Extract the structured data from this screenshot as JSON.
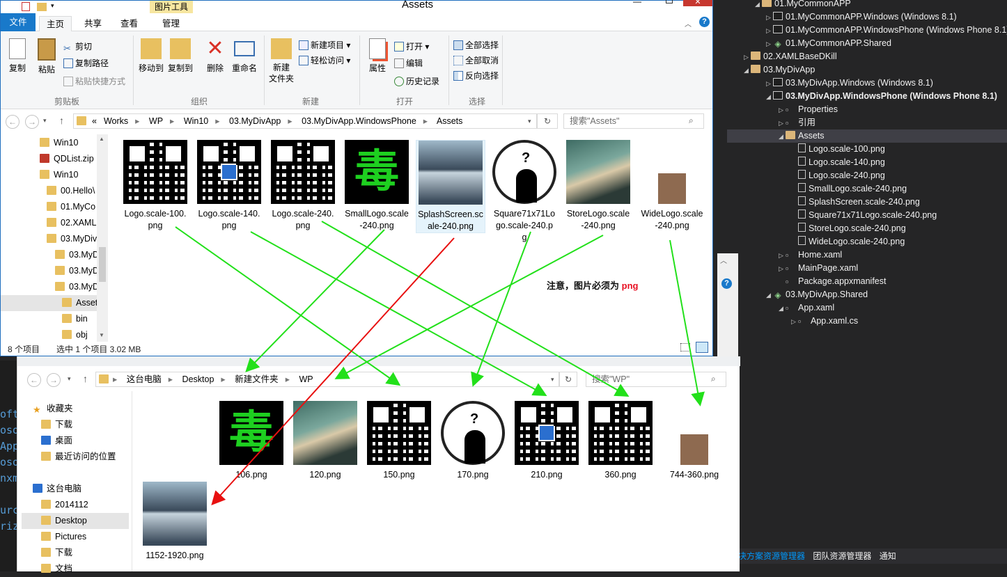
{
  "window1": {
    "title": "Assets",
    "tool_tab": "图片工具",
    "tabs": [
      "文件",
      "主页",
      "共享",
      "查看",
      "管理"
    ],
    "ribbon": {
      "clipboard": {
        "copy": "复制",
        "paste": "粘贴",
        "cut": "剪切",
        "copy_path": "复制路径",
        "paste_shortcut": "粘贴快捷方式",
        "label": "剪贴板"
      },
      "organize": {
        "move_to": "移动到",
        "copy_to": "复制到",
        "delete": "删除",
        "rename": "重命名",
        "label": "组织"
      },
      "new": {
        "new_folder": "新建\n文件夹",
        "new_item": "新建项目",
        "easy_access": "轻松访问",
        "label": "新建"
      },
      "open": {
        "properties": "属性",
        "open": "打开",
        "edit": "编辑",
        "history": "历史记录",
        "label": "打开"
      },
      "select": {
        "select_all": "全部选择",
        "select_none": "全部取消",
        "invert": "反向选择",
        "label": "选择"
      }
    },
    "breadcrumb": [
      "Works",
      "WP",
      "Win10",
      "03.MyDivApp",
      "03.MyDivApp.WindowsPhone",
      "Assets"
    ],
    "breadcrumb_prefix": "«",
    "search_placeholder": "搜索\"Assets\"",
    "nav_items": [
      "Win10",
      "QDList.zip",
      "Win10",
      "00.Hello\\",
      "01.MyCo",
      "02.XAML",
      "03.MyDiv",
      "03.MyD",
      "03.MyD",
      "03.MyD",
      "Asset",
      "bin",
      "obj"
    ],
    "files": [
      "Logo.scale-100.png",
      "Logo.scale-140.png",
      "Logo.scale-240.png",
      "SmallLogo.scale-240.png",
      "SplashScreen.scale-240.png",
      "Square71x71Logo.scale-240.png",
      "StoreLogo.scale-240.png",
      "WideLogo.scale-240.png"
    ],
    "file_labels": [
      [
        "Logo.scale-100.",
        "png"
      ],
      [
        "Logo.scale-140.",
        "png"
      ],
      [
        "Logo.scale-240.",
        "png"
      ],
      [
        "SmallLogo.scale",
        "-240.png"
      ],
      [
        "SplashScreen.sc",
        "ale-240.png"
      ],
      [
        "Square71x71Lo",
        "go.scale-240.p",
        "g"
      ],
      [
        "StoreLogo.scale",
        "-240.png"
      ],
      [
        "WideLogo.scale",
        "-240.png"
      ]
    ],
    "status_count": "8 个项目",
    "status_selected": "选中 1 个项目  3.02 MB"
  },
  "annotation": {
    "text": "注意，图片必须为 ",
    "highlight": "png",
    "highlight_color": "#e81123"
  },
  "window2": {
    "breadcrumb": [
      "这台电脑",
      "Desktop",
      "新建文件夹",
      "WP"
    ],
    "search_placeholder": "搜索\"WP\"",
    "nav_items": [
      "收藏夹",
      "下载",
      "桌面",
      "最近访问的位置",
      "这台电脑",
      "2014112",
      "Desktop",
      "Pictures",
      "下载",
      "文档"
    ],
    "files": [
      "106.png",
      "120.png",
      "150.png",
      "170.png",
      "210.png",
      "360.png",
      "744-360.png",
      "1152-1920.png"
    ]
  },
  "solution_explorer": {
    "rows": [
      {
        "text": "01.MyCommonAPP",
        "icon": "folder-icon",
        "tri": "◢"
      },
      {
        "text": "01.MyCommonAPP.Windows (Windows 8.1)",
        "icon": "project-icon",
        "tri": "▷"
      },
      {
        "text": "01.MyCommonAPP.WindowsPhone (Windows Phone 8.1)",
        "icon": "project-icon",
        "tri": "▷"
      },
      {
        "text": "01.MyCommonAPP.Shared",
        "icon": "shared-icon",
        "tri": "▷"
      },
      {
        "text": "02.XAMLBaseDKill",
        "icon": "folder-icon",
        "tri": "▷"
      },
      {
        "text": "03.MyDivApp",
        "icon": "folder-icon",
        "tri": "◢"
      },
      {
        "text": "03.MyDivApp.Windows (Windows 8.1)",
        "icon": "project-icon",
        "tri": "▷"
      },
      {
        "text": "03.MyDivApp.WindowsPhone (Windows Phone 8.1)",
        "icon": "project-icon",
        "tri": "◢"
      },
      {
        "text": "Properties",
        "icon": "wrench-icon",
        "tri": "▷"
      },
      {
        "text": "引用",
        "icon": "reference-icon",
        "tri": "▷"
      },
      {
        "text": "Assets",
        "icon": "folder-icon",
        "tri": "◢"
      },
      {
        "text": "Logo.scale-100.png",
        "icon": "image-icon",
        "tri": ""
      },
      {
        "text": "Logo.scale-140.png",
        "icon": "image-icon",
        "tri": ""
      },
      {
        "text": "Logo.scale-240.png",
        "icon": "image-icon",
        "tri": ""
      },
      {
        "text": "SmallLogo.scale-240.png",
        "icon": "image-icon",
        "tri": ""
      },
      {
        "text": "SplashScreen.scale-240.png",
        "icon": "image-icon",
        "tri": ""
      },
      {
        "text": "Square71x71Logo.scale-240.png",
        "icon": "image-icon",
        "tri": ""
      },
      {
        "text": "StoreLogo.scale-240.png",
        "icon": "image-icon",
        "tri": ""
      },
      {
        "text": "WideLogo.scale-240.png",
        "icon": "image-icon",
        "tri": ""
      },
      {
        "text": "Home.xaml",
        "icon": "xaml-icon",
        "tri": "▷"
      },
      {
        "text": "MainPage.xaml",
        "icon": "xaml-icon",
        "tri": "▷"
      },
      {
        "text": "Package.appxmanifest",
        "icon": "manifest-icon",
        "tri": ""
      },
      {
        "text": "03.MyDivApp.Shared",
        "icon": "shared-icon",
        "tri": "◢"
      },
      {
        "text": "App.xaml",
        "icon": "xaml-icon",
        "tri": "◢"
      },
      {
        "text": "App.xaml.cs",
        "icon": "cs-icon",
        "tri": "▷"
      }
    ],
    "tabs": [
      "决方案资源管理器",
      "团队资源管理器",
      "通知"
    ]
  },
  "code_strip": [
    "oft",
    "oso",
    "App",
    "oso",
    "nxm",
    "",
    "urc",
    "riz"
  ],
  "colors": {
    "arrow_green": "#22e01a",
    "arrow_red": "#e81010",
    "ribbon_file": "#1979ca",
    "vs_bg": "#252526"
  }
}
